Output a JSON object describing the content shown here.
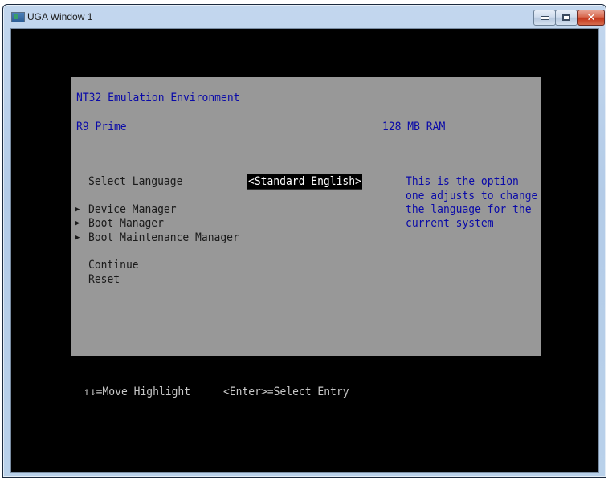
{
  "window": {
    "title": "UGA Window 1",
    "controls": {
      "minimize": "minimize",
      "maximize": "maximize",
      "close": "✕"
    }
  },
  "header": {
    "environment": "NT32 Emulation Environment",
    "processor": "R9 Prime",
    "memory": "128 MB RAM"
  },
  "menu": {
    "select_language_label": "Select Language",
    "select_language_value": "<Standard English>",
    "items": [
      {
        "label": "Device Manager",
        "submenu": true
      },
      {
        "label": "Boot Manager",
        "submenu": true
      },
      {
        "label": "Boot Maintenance Manager",
        "submenu": true
      }
    ],
    "actions": [
      {
        "label": "Continue"
      },
      {
        "label": "Reset"
      }
    ],
    "arrow_glyph": "▶"
  },
  "help": {
    "lines": [
      "This is the option",
      "one adjusts to change",
      "the language for the",
      "current system"
    ]
  },
  "footer": {
    "move_hint": "↑↓=Move Highlight",
    "select_hint": "<Enter>=Select Entry"
  },
  "colors": {
    "panel_gray": "#989898",
    "info_blue": "#0a0aa8",
    "highlight_bg": "#000000",
    "highlight_fg": "#ffffff"
  }
}
